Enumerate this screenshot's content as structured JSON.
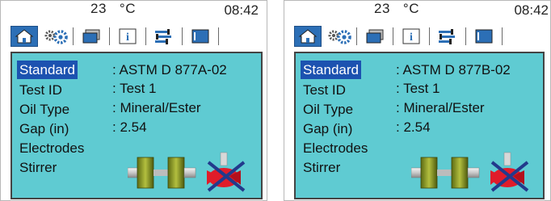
{
  "screens": [
    {
      "header": {
        "temperature": "23",
        "unit": "°C",
        "time": "08:42"
      },
      "tabs": [
        "home",
        "settings",
        "folder",
        "info",
        "adjust",
        "chart"
      ],
      "rows": [
        {
          "label": "Standard",
          "value": ": ASTM D 877A-02",
          "selected": true
        },
        {
          "label": "Test ID",
          "value": ": Test 1"
        },
        {
          "label": "Oil Type",
          "value": ": Mineral/Ester"
        },
        {
          "label": "Gap (in)",
          "value": ": 2.54"
        },
        {
          "label": "Electrodes",
          "value": ""
        },
        {
          "label": "Stirrer",
          "value": ""
        }
      ],
      "graphics": {
        "electrodes_icon": "disc-electrodes-icon",
        "stirrer_icon": "stirrer-disabled-icon"
      }
    },
    {
      "header": {
        "temperature": "23",
        "unit": "°C",
        "time": "08:42"
      },
      "tabs": [
        "home",
        "settings",
        "folder",
        "info",
        "adjust",
        "chart"
      ],
      "rows": [
        {
          "label": "Standard",
          "value": ": ASTM D 877B-02",
          "selected": true
        },
        {
          "label": "Test ID",
          "value": ": Test 1"
        },
        {
          "label": "Oil Type",
          "value": ": Mineral/Ester"
        },
        {
          "label": "Gap (in)",
          "value": ": 2.54"
        },
        {
          "label": "Electrodes",
          "value": ""
        },
        {
          "label": "Stirrer",
          "value": ""
        }
      ],
      "graphics": {
        "electrodes_icon": "disc-electrodes-icon",
        "stirrer_icon": "stirrer-disabled-icon"
      }
    }
  ],
  "colors": {
    "selection": "#1c52b0",
    "panel": "#5fcbd2",
    "home_tab": "#2c6fb6"
  }
}
